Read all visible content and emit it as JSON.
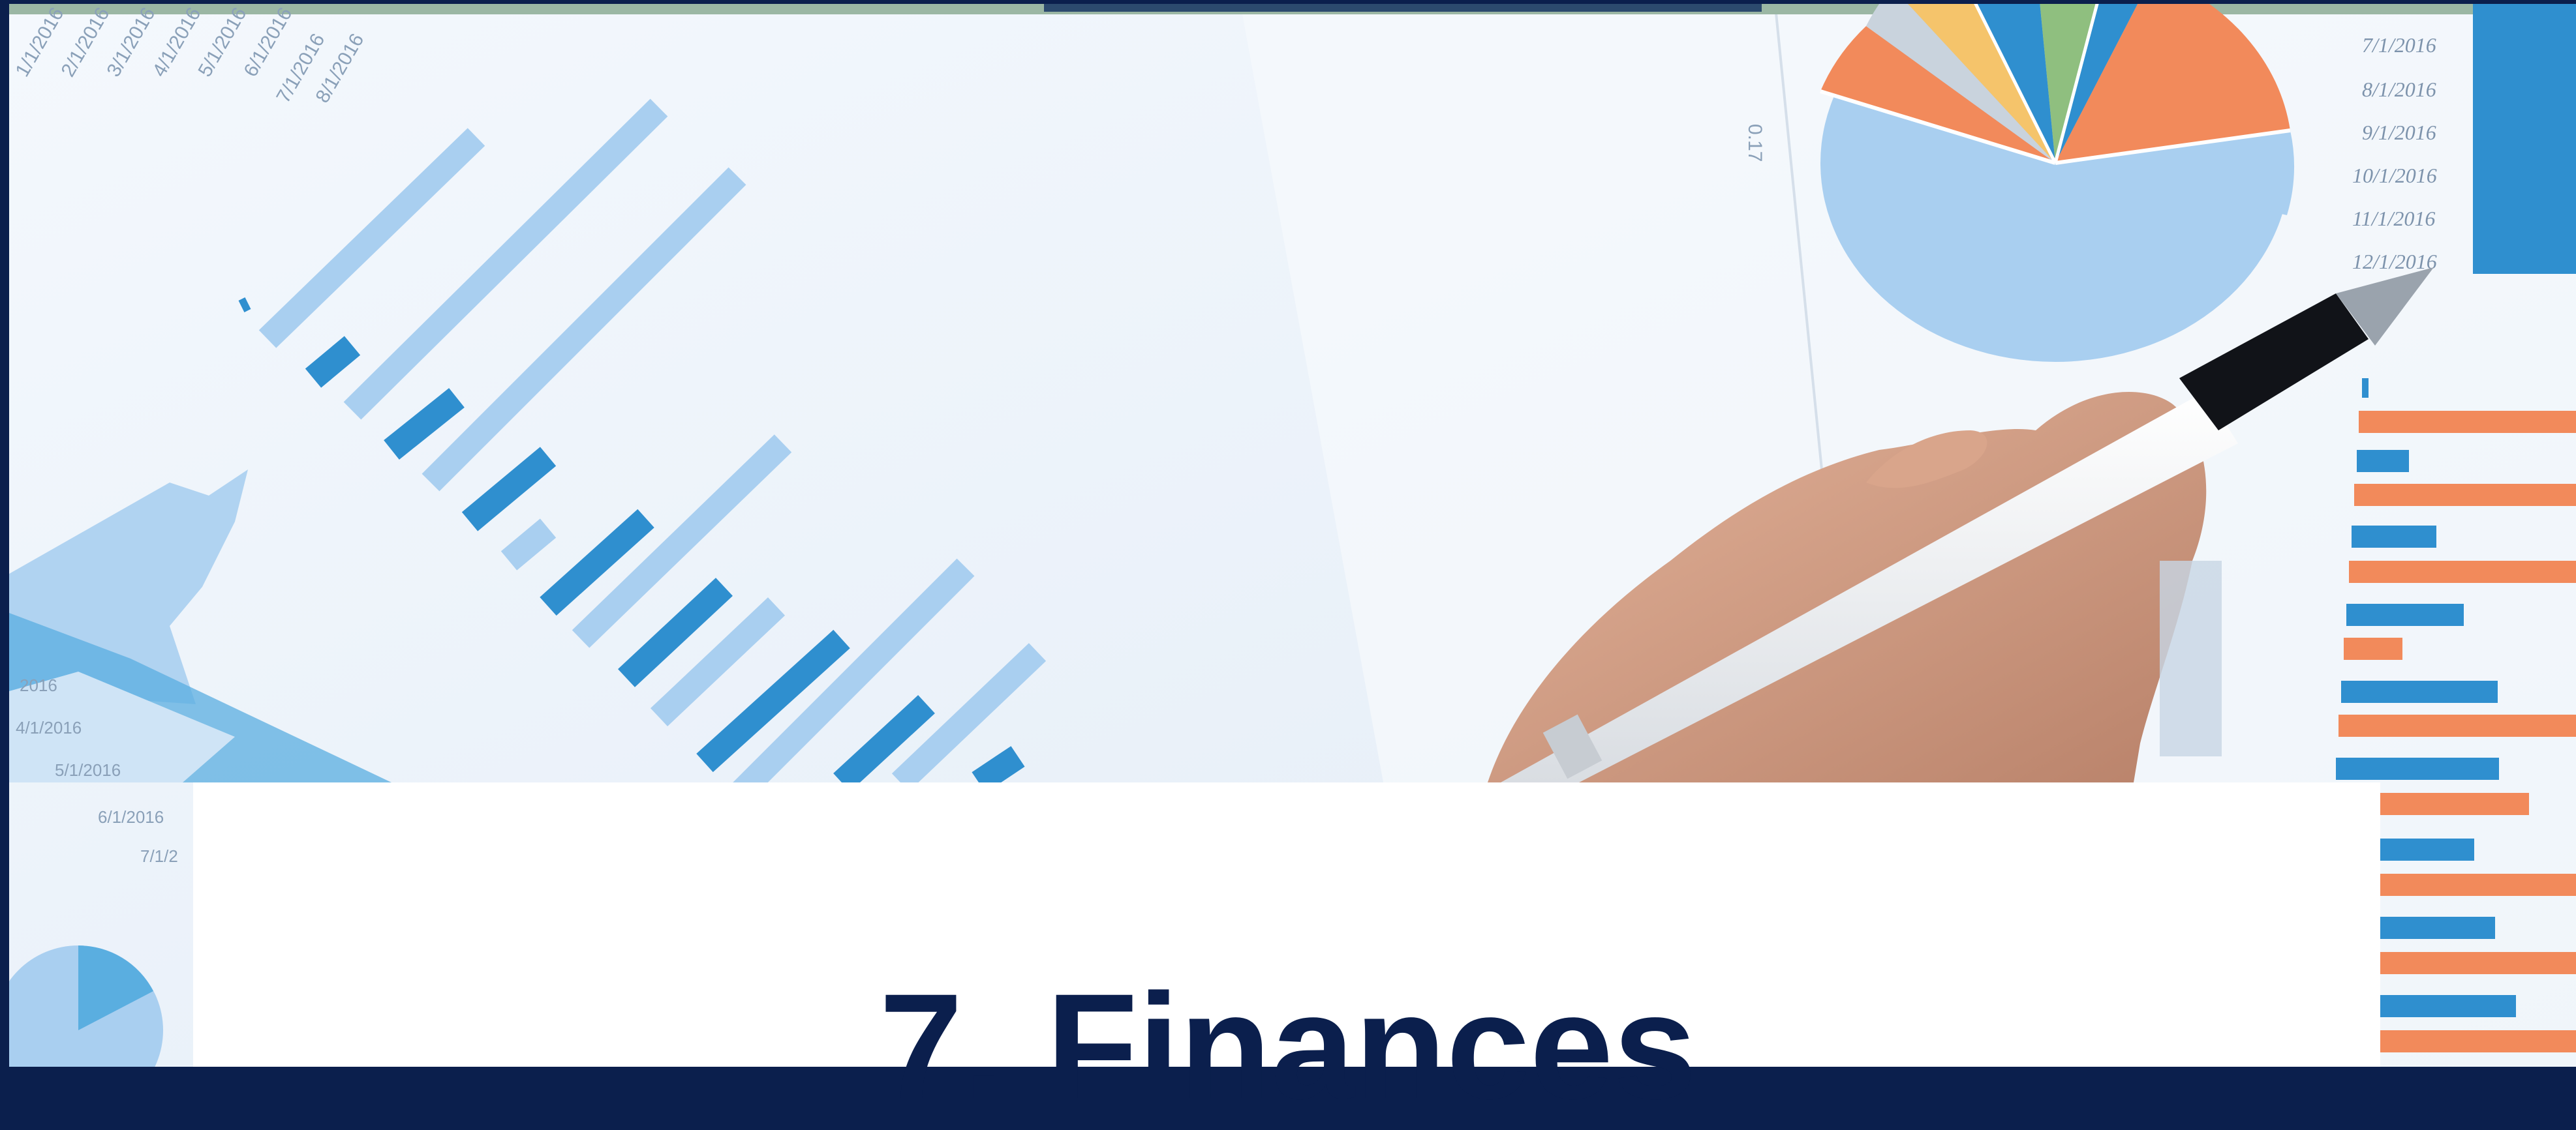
{
  "slide": {
    "title": "7. Finances"
  },
  "background": {
    "image": "finance-charts-photo",
    "printed_dates_right": [
      "7/1/2016",
      "8/1/2016",
      "9/1/2016",
      "10/1/2016",
      "11/1/2016",
      "12/1/2016"
    ],
    "printed_dates_left": [
      "2016",
      "4/1/2016",
      "5/1/2016",
      "6/1/2016",
      "7/1/2"
    ],
    "printed_value": "0.17"
  },
  "colors": {
    "navy": "#0b1f4d",
    "bar_light": "#a9cff0",
    "bar_mid": "#5aaee0",
    "bar_dark": "#2f8fcf",
    "orange": "#f28a5b",
    "paper": "#eef4fb",
    "card": "#ffffff"
  }
}
